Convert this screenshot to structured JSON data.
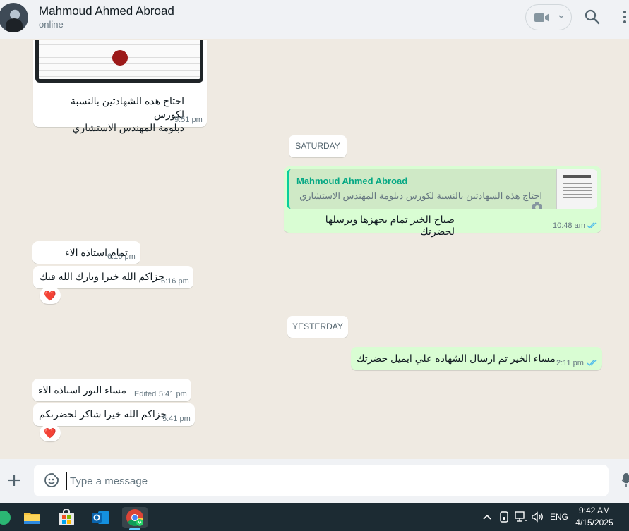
{
  "header": {
    "contact_name": "Mahmoud Ahmed Abroad",
    "status": "online"
  },
  "messages": [
    {
      "direction": "in",
      "type": "image",
      "caption_line1": "احتاج هذه الشهادتين بالنسبة لكورس",
      "caption_line2": "دبلومة المهندس الاستشاري",
      "time": "9:51 pm"
    },
    {
      "type": "date",
      "label": "SATURDAY"
    },
    {
      "direction": "out",
      "type": "reply",
      "quoted_name": "Mahmoud Ahmed Abroad",
      "quoted_text": "احتاج هذه الشهادتين بالنسبة لكورس دبلومة المهندس الاستشاري",
      "text": "صباح الخير تمام بجهزها وبرسلها لحضرتك",
      "time": "10:48 am",
      "read": true
    },
    {
      "direction": "in",
      "text": "تمام استاذه الاء",
      "time": "6:16 pm"
    },
    {
      "direction": "in",
      "text": "جزاكم الله خيرا وبارك الله فيك",
      "time": "6:16 pm",
      "reaction": "❤️"
    },
    {
      "type": "date",
      "label": "YESTERDAY"
    },
    {
      "direction": "out",
      "text": "مساء الخير تم ارسال الشهاده علي ايميل حضرتك",
      "time": "2:11 pm",
      "read": true
    },
    {
      "direction": "in",
      "text": "مساء النور استاذه الاء",
      "edited_label": "Edited",
      "time": "5:41 pm"
    },
    {
      "direction": "in",
      "text": "جزاكم الله خيرا شاكر لحضرتكم",
      "time": "5:41 pm",
      "reaction": "❤️"
    }
  ],
  "composer": {
    "placeholder": "Type a message"
  },
  "taskbar": {
    "language": "ENG",
    "time": "9:42 AM",
    "date": "4/15/2025"
  },
  "colors": {
    "incoming_bubble": "#ffffff",
    "outgoing_bubble": "#d9fdd3",
    "read_ticks": "#53bdeb",
    "chat_background": "#efeae2",
    "quote_accent": "#06cf9c"
  }
}
